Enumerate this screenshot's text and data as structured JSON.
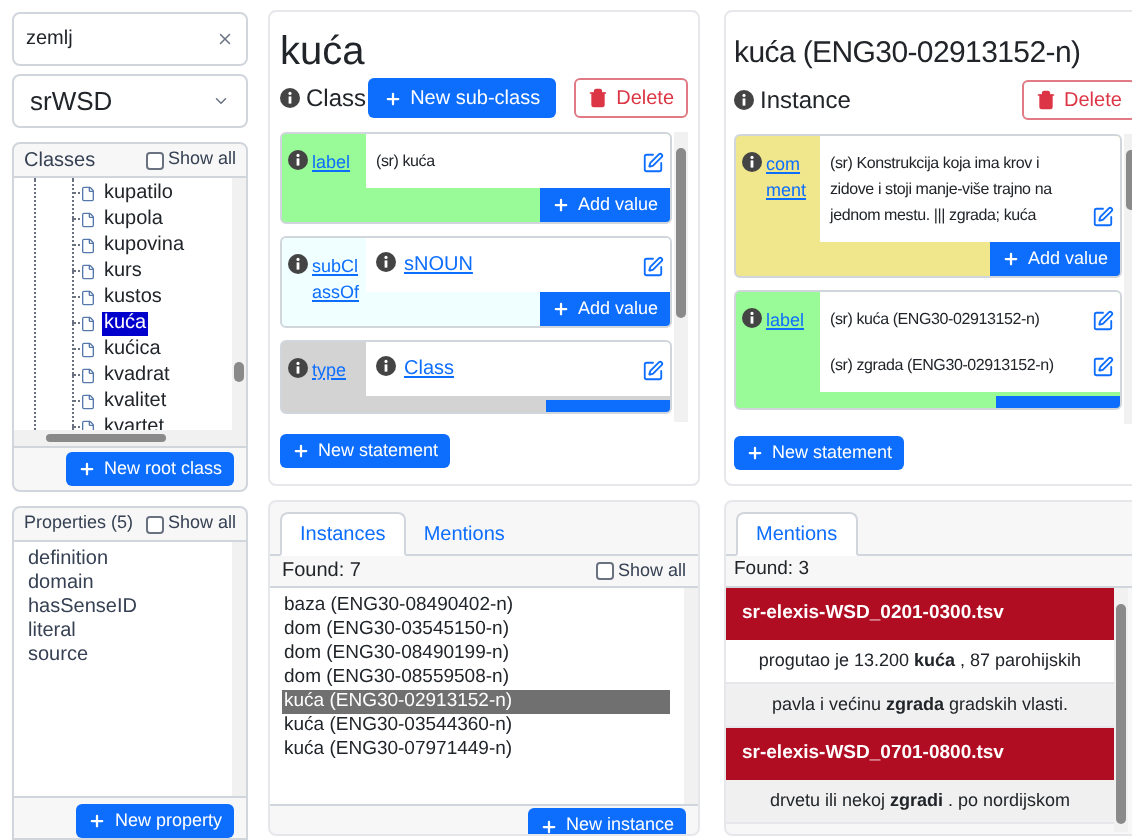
{
  "search": {
    "value": "zemlj"
  },
  "dataset_select": {
    "value": "srWSD"
  },
  "classes_panel": {
    "title": "Classes",
    "show_all": {
      "label": "Show all",
      "checked": false
    },
    "items": [
      {
        "label": "kupatilo",
        "selected": false
      },
      {
        "label": "kupola",
        "selected": false
      },
      {
        "label": "kupovina",
        "selected": false
      },
      {
        "label": "kurs",
        "selected": false
      },
      {
        "label": "kustos",
        "selected": false
      },
      {
        "label": "kuća",
        "selected": true
      },
      {
        "label": "kućica",
        "selected": false
      },
      {
        "label": "kvadrat",
        "selected": false
      },
      {
        "label": "kvalitet",
        "selected": false
      },
      {
        "label": "kvartet",
        "selected": false
      }
    ],
    "button": "New root class"
  },
  "properties_panel": {
    "title": "Properties (5)",
    "show_all": {
      "label": "Show all",
      "checked": false
    },
    "items": [
      "definition",
      "domain",
      "hasSenseID",
      "literal",
      "source"
    ],
    "button": "New property"
  },
  "class_panel": {
    "title": "kuća",
    "type": "Class",
    "new_button": "New sub-class",
    "delete_button": "Delete",
    "statements": [
      {
        "property": "label",
        "color": "#98fb98",
        "values": [
          {
            "kind": "literal",
            "text": "(sr) kuća"
          }
        ],
        "add_button": "Add value"
      },
      {
        "property": "subClassOf",
        "color": "#f0ffff",
        "values": [
          {
            "kind": "link",
            "text": "sNOUN"
          }
        ],
        "add_button": "Add value"
      },
      {
        "property": "type",
        "color": "#d3d3d3",
        "values": [
          {
            "kind": "link",
            "text": "Class"
          }
        ]
      }
    ],
    "new_statement": "New statement"
  },
  "instance_panel": {
    "title": "kuća (ENG30-02913152-n)",
    "type": "Instance",
    "delete_button": "Delete",
    "statements": [
      {
        "property": "comment",
        "color": "#f0e68c",
        "values": [
          {
            "kind": "literal",
            "text": "(sr) Konstrukcija koja ima krov i zidove i stoji manje-više trajno na jednom mestu. ||| zgrada; kuća"
          }
        ],
        "add_button": "Add value"
      },
      {
        "property": "label",
        "color": "#98fb98",
        "values": [
          {
            "kind": "literal",
            "text": "(sr) kuća (ENG30-02913152-n)"
          },
          {
            "kind": "literal",
            "text": "(sr) zgrada (ENG30-02913152-n)"
          }
        ]
      }
    ],
    "new_statement": "New statement"
  },
  "instances_panel": {
    "tabs": [
      {
        "label": "Instances",
        "selected": true
      },
      {
        "label": "Mentions",
        "selected": false
      }
    ],
    "found": "Found: 7",
    "show_all": {
      "label": "Show all",
      "checked": false
    },
    "items": [
      {
        "label": "baza (ENG30-08490402-n)",
        "selected": false
      },
      {
        "label": "dom (ENG30-03545150-n)",
        "selected": false
      },
      {
        "label": "dom (ENG30-08490199-n)",
        "selected": false
      },
      {
        "label": "dom (ENG30-08559508-n)",
        "selected": false
      },
      {
        "label": "kuća (ENG30-02913152-n)",
        "selected": true
      },
      {
        "label": "kuća (ENG30-03544360-n)",
        "selected": false
      },
      {
        "label": "kuća (ENG30-07971449-n)",
        "selected": false
      }
    ],
    "button": "New instance"
  },
  "mentions_panel": {
    "tabs": [
      {
        "label": "Mentions",
        "selected": true
      }
    ],
    "found": "Found: 3",
    "items": [
      {
        "kind": "file",
        "text": "**sr-elexis-WSD_0201-0300.tsv**"
      },
      {
        "kind": "sentence",
        "text": "progutao je 13.200 **kuća** , 87 parohijskih",
        "shaded": false
      },
      {
        "kind": "sentence",
        "text": "pavla i većinu **zgrada** gradskih vlasti.",
        "shaded": true
      },
      {
        "kind": "file",
        "text": "**sr-elexis-WSD_0701-0800.tsv**"
      },
      {
        "kind": "sentence",
        "text": "drvetu ili nekoj **zgradi** . po nordijskom",
        "shaded": true
      }
    ]
  }
}
